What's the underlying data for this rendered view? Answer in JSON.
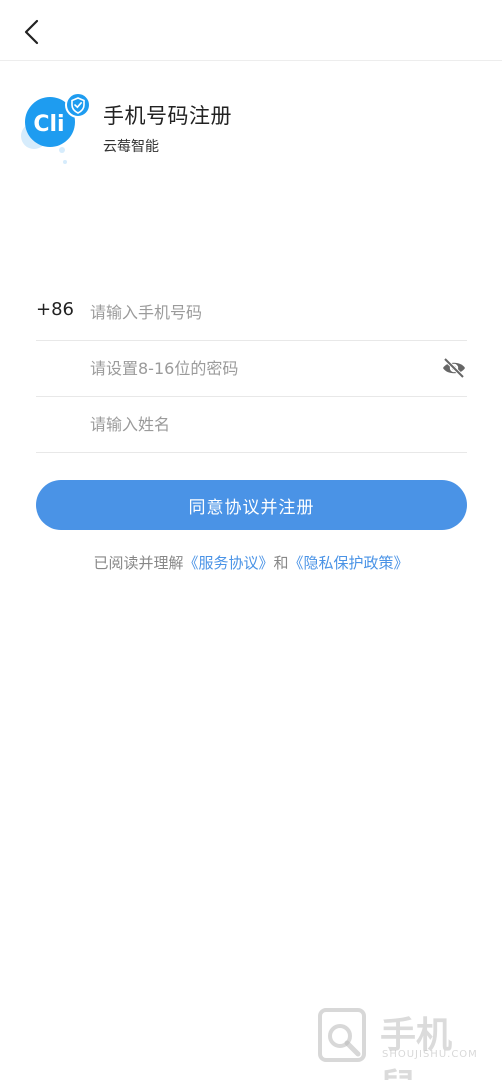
{
  "header": {
    "title": "手机号码注册",
    "subtitle": "云莓智能"
  },
  "form": {
    "country_code": "+86",
    "phone_placeholder": "请输入手机号码",
    "password_placeholder": "请设置8-16位的密码",
    "name_placeholder": "请输入姓名"
  },
  "submit_label": "同意协议并注册",
  "agreement": {
    "prefix": "已阅读并理解",
    "service_link": "《服务协议》",
    "and": "和",
    "privacy_link": "《隐私保护政策》"
  },
  "watermark": {
    "text": "手机鼠",
    "sub": "SHOUJISHU.COM"
  },
  "colors": {
    "accent": "#4a93e6",
    "logo": "#1e9cf0"
  }
}
